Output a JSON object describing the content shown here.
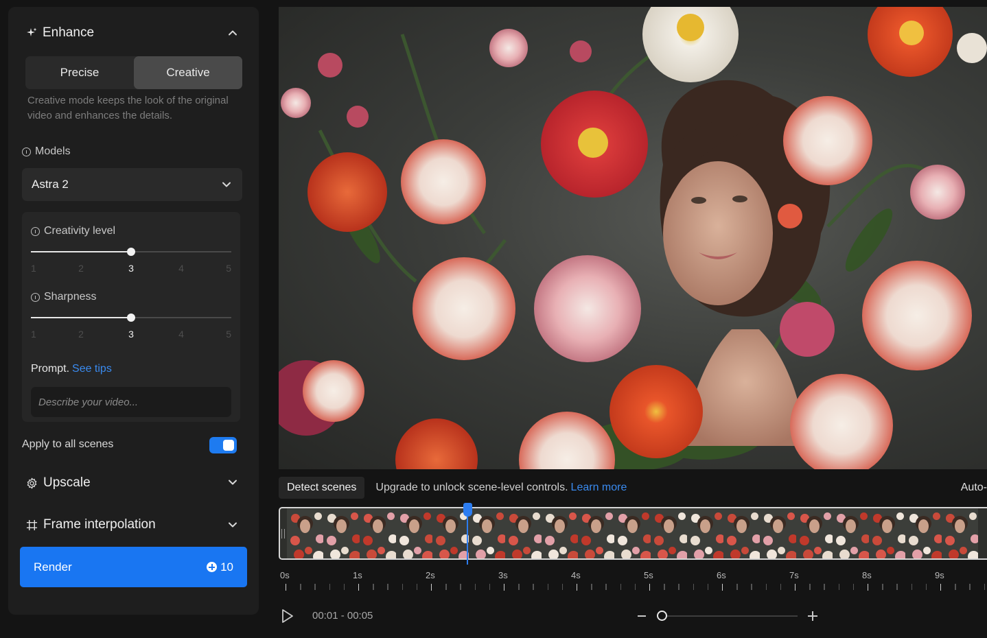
{
  "panel": {
    "enhance": {
      "title": "Enhance",
      "icon": "sparkle-icon",
      "expanded": true
    },
    "mode": {
      "options": [
        "Precise",
        "Creative"
      ],
      "selected": "Creative",
      "description": "Creative mode keeps the look of the original video and enhances the details."
    },
    "models": {
      "label": "Models",
      "selected": "Astra 2"
    },
    "creativity": {
      "label": "Creativity level",
      "value": 3,
      "min": 1,
      "max": 5,
      "ticks": [
        "1",
        "2",
        "3",
        "4",
        "5"
      ]
    },
    "sharpness": {
      "label": "Sharpness",
      "value": 3,
      "min": 1,
      "max": 5,
      "ticks": [
        "1",
        "2",
        "3",
        "4",
        "5"
      ]
    },
    "prompt": {
      "label": "Prompt.",
      "link": "See tips",
      "placeholder": "Describe your video..."
    },
    "apply_all": {
      "label": "Apply to all scenes",
      "on": true
    },
    "upscale": {
      "title": "Upscale",
      "icon": "gear-icon"
    },
    "frame_interp": {
      "title": "Frame interpolation",
      "icon": "grid-icon"
    },
    "render": {
      "label": "Render",
      "credits": "10"
    }
  },
  "scenes": {
    "detect_label": "Detect scenes",
    "upgrade_text": "Upgrade to unlock scene-level controls.",
    "learn_more": "Learn more",
    "auto_label": "Auto-"
  },
  "timeline": {
    "labels": [
      "0s",
      "1s",
      "2s",
      "3s",
      "4s",
      "5s",
      "6s",
      "7s",
      "8s",
      "9s"
    ],
    "playhead_seconds": 2.5,
    "frame_count": 19
  },
  "transport": {
    "time_range": "00:01 - 00:05",
    "zoom": 0
  },
  "colors": {
    "accent": "#1976f2",
    "link": "#3a8bf0",
    "panel": "#1e1e1e"
  }
}
